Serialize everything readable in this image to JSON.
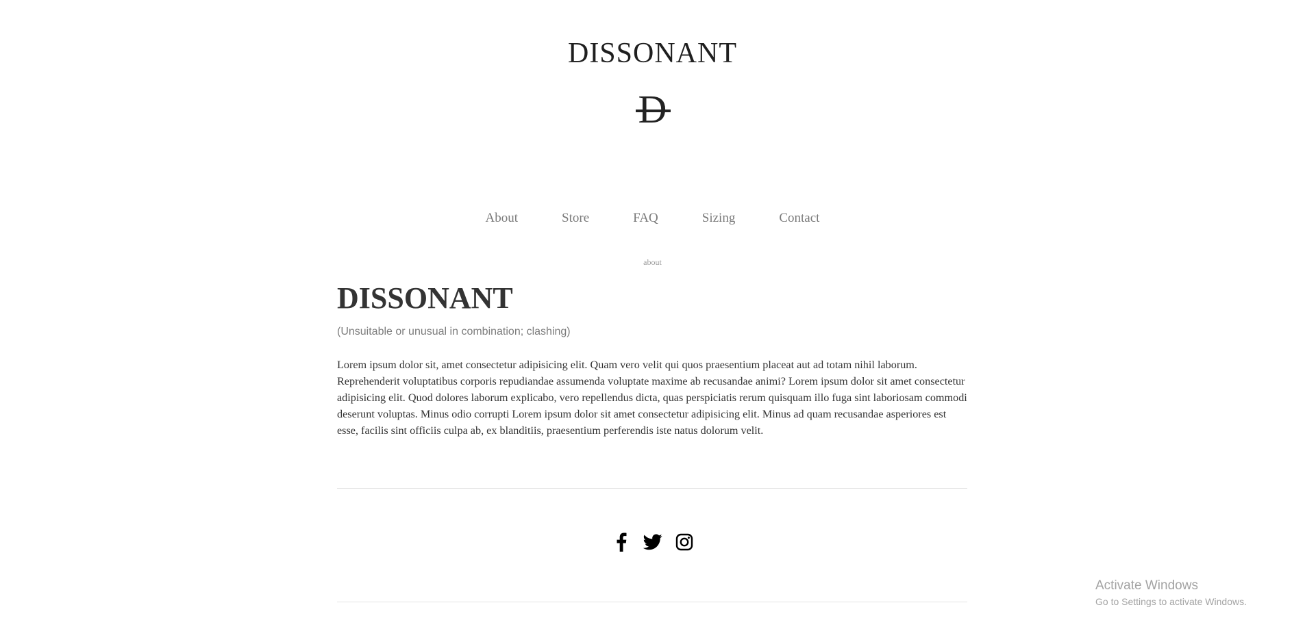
{
  "brand": {
    "title": "DISSONANT",
    "logo_glyph": "D"
  },
  "nav": {
    "items": [
      {
        "label": "About"
      },
      {
        "label": "Store"
      },
      {
        "label": "FAQ"
      },
      {
        "label": "Sizing"
      },
      {
        "label": "Contact"
      }
    ]
  },
  "page": {
    "label": "about"
  },
  "main": {
    "heading": "DISSONANT",
    "subtitle": "(Unsuitable or unusual in combination; clashing)",
    "body": "Lorem ipsum dolor sit, amet consectetur adipisicing elit. Quam vero velit qui quos praesentium placeat aut ad totam nihil laborum. Reprehenderit voluptatibus corporis repudiandae assumenda voluptate maxime ab recusandae animi? Lorem ipsum dolor sit amet consectetur adipisicing elit. Quod dolores laborum explicabo, vero repellendus dicta, quas perspiciatis rerum quisquam illo fuga sint laboriosam commodi deserunt voluptas. Minus odio corrupti Lorem ipsum dolor sit amet consectetur adipisicing elit. Minus ad quam recusandae asperiores est esse, facilis sint officiis culpa ab, ex blanditiis, praesentium perferendis iste natus dolorum velit."
  },
  "footer": {
    "social_icons": [
      "facebook-icon",
      "twitter-icon",
      "instagram-icon"
    ]
  },
  "os_overlay": {
    "line1": "Activate Windows",
    "line2": "Go to Settings to activate Windows."
  },
  "colors": {
    "text_dark": "#333333",
    "nav_text": "#7a7a7a",
    "divider": "#e3e3e3"
  }
}
